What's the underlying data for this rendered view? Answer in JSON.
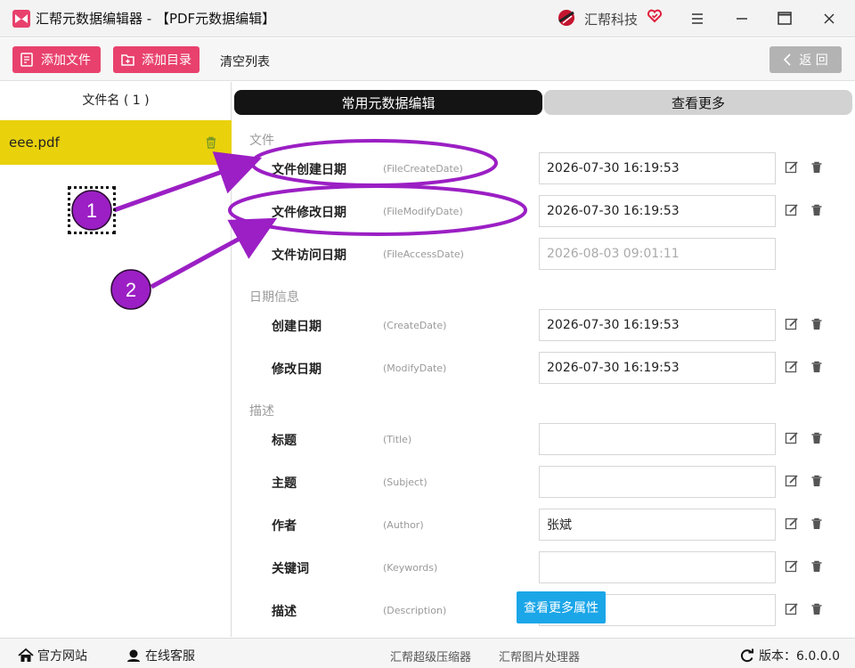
{
  "window": {
    "title": "汇帮元数据编辑器 - 【PDF元数据编辑】",
    "brand_name": "汇帮科技"
  },
  "toolbar": {
    "add_file_label": "添加文件",
    "add_dir_label": "添加目录",
    "clear_label": "清空列表",
    "back_label": "返 回"
  },
  "file_list": {
    "header": "文件名 ( 1 )",
    "items": [
      {
        "name": "eee.pdf"
      }
    ]
  },
  "tabs": {
    "common": "常用元数据编辑",
    "more": "查看更多"
  },
  "sections": {
    "file": {
      "title": "文件",
      "fields": [
        {
          "label": "文件创建日期",
          "key": "(FileCreateDate)",
          "value": "2026-07-30 16:19:53",
          "editable": true
        },
        {
          "label": "文件修改日期",
          "key": "(FileModifyDate)",
          "value": "2026-07-30 16:19:53",
          "editable": true
        },
        {
          "label": "文件访问日期",
          "key": "(FileAccessDate)",
          "value": "2026-08-03 09:01:11",
          "editable": false
        }
      ]
    },
    "date": {
      "title": "日期信息",
      "fields": [
        {
          "label": "创建日期",
          "key": "(CreateDate)",
          "value": "2026-07-30 16:19:53",
          "editable": true
        },
        {
          "label": "修改日期",
          "key": "(ModifyDate)",
          "value": "2026-07-30 16:19:53",
          "editable": true
        }
      ]
    },
    "desc": {
      "title": "描述",
      "fields": [
        {
          "label": "标题",
          "key": "(Title)",
          "value": "",
          "editable": true
        },
        {
          "label": "主题",
          "key": "(Subject)",
          "value": "",
          "editable": true
        },
        {
          "label": "作者",
          "key": "(Author)",
          "value": "张斌",
          "editable": true
        },
        {
          "label": "关键词",
          "key": "(Keywords)",
          "value": "",
          "editable": true
        },
        {
          "label": "描述",
          "key": "(Description)",
          "value": "",
          "editable": true
        }
      ]
    }
  },
  "more_attrs_label": "查看更多属性",
  "footer": {
    "website": "官方网站",
    "support": "在线客服",
    "compressor": "汇帮超级压缩器",
    "image_tool": "汇帮图片处理器",
    "version": "版本：6.0.0.0"
  },
  "annotations": {
    "marker1": "1",
    "marker2": "2"
  },
  "colors": {
    "accent_pink": "#e8416d",
    "selected_row": "#e9d10c",
    "annotation_purple": "#9b1fc4",
    "more_button": "#1ba6e8"
  }
}
